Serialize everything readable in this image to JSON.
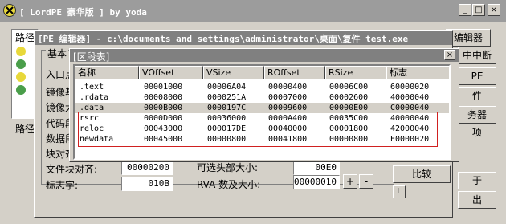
{
  "main_window": {
    "title": "[ LordPE 豪华版 ] by yoda",
    "min_label": "_",
    "max_label": "□",
    "close_label": "×"
  },
  "background": {
    "path_label": "路径",
    "path_label2": "路径"
  },
  "right_buttons": {
    "btn1": "编辑器",
    "btn2": "中中断",
    "btn3": "PE",
    "btn4": "件",
    "btn5": "务器",
    "btn6": "项",
    "btn7": "于",
    "btn8": "出"
  },
  "pe_editor": {
    "title": "[PE 编辑器] - c:\\documents and settings\\administrator\\桌面\\复件 test.exe",
    "basic_group": "基本",
    "labels": [
      "入口点",
      "镜像基",
      "镜像大",
      "代码段",
      "数据段",
      "块对齐",
      "文件块对齐:",
      "标志字:"
    ],
    "file_align_value": "00000200",
    "flags_value": "010B",
    "header_size_label": "可选头部大小:",
    "header_size_value": "00E0",
    "rva_label": "RVA 数及大小:",
    "rva_value": "00000010",
    "plus_label": "+",
    "minus_label": "-",
    "compare_label": "比较",
    "l_label": "L"
  },
  "section_table": {
    "title": "[区段表]",
    "close_label": "×",
    "columns": [
      "名称",
      "VOffset",
      "VSize",
      "ROffset",
      "RSize",
      "标志"
    ],
    "rows": [
      [
        ".text",
        "00001000",
        "00006A04",
        "00000400",
        "00006C00",
        "60000020"
      ],
      [
        ".rdata",
        "00008000",
        "0000251A",
        "00007000",
        "00002600",
        "40000040"
      ],
      [
        ".data",
        "0000B000",
        "0000197C",
        "00009600",
        "00000E00",
        "C0000040"
      ],
      [
        "rsrc",
        "0000D000",
        "00036000",
        "0000A400",
        "00035C00",
        "40000040"
      ],
      [
        "reloc",
        "00043000",
        "000017DE",
        "00040000",
        "00001800",
        "42000040"
      ],
      [
        "newdata",
        "00045000",
        "00000800",
        "00041800",
        "00000800",
        "E0000020"
      ]
    ]
  }
}
